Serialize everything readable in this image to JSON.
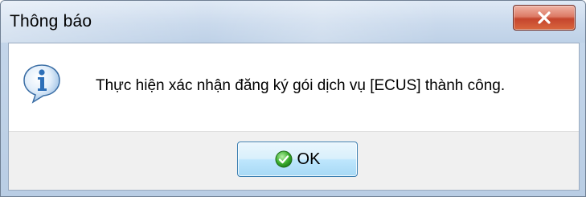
{
  "window": {
    "title": "Thông báo"
  },
  "dialog": {
    "message": "Thực hiện xác nhận đăng ký gói dịch vụ [ECUS] thành công.",
    "icon": "info-icon"
  },
  "buttons": {
    "ok_label": "OK",
    "ok_icon": "check-icon",
    "close_icon": "close-icon"
  },
  "colors": {
    "close_button": "#c5452d",
    "ok_button": "#bee6fd",
    "info_icon": "#2d6fb8",
    "check_icon": "#3cae2e"
  }
}
